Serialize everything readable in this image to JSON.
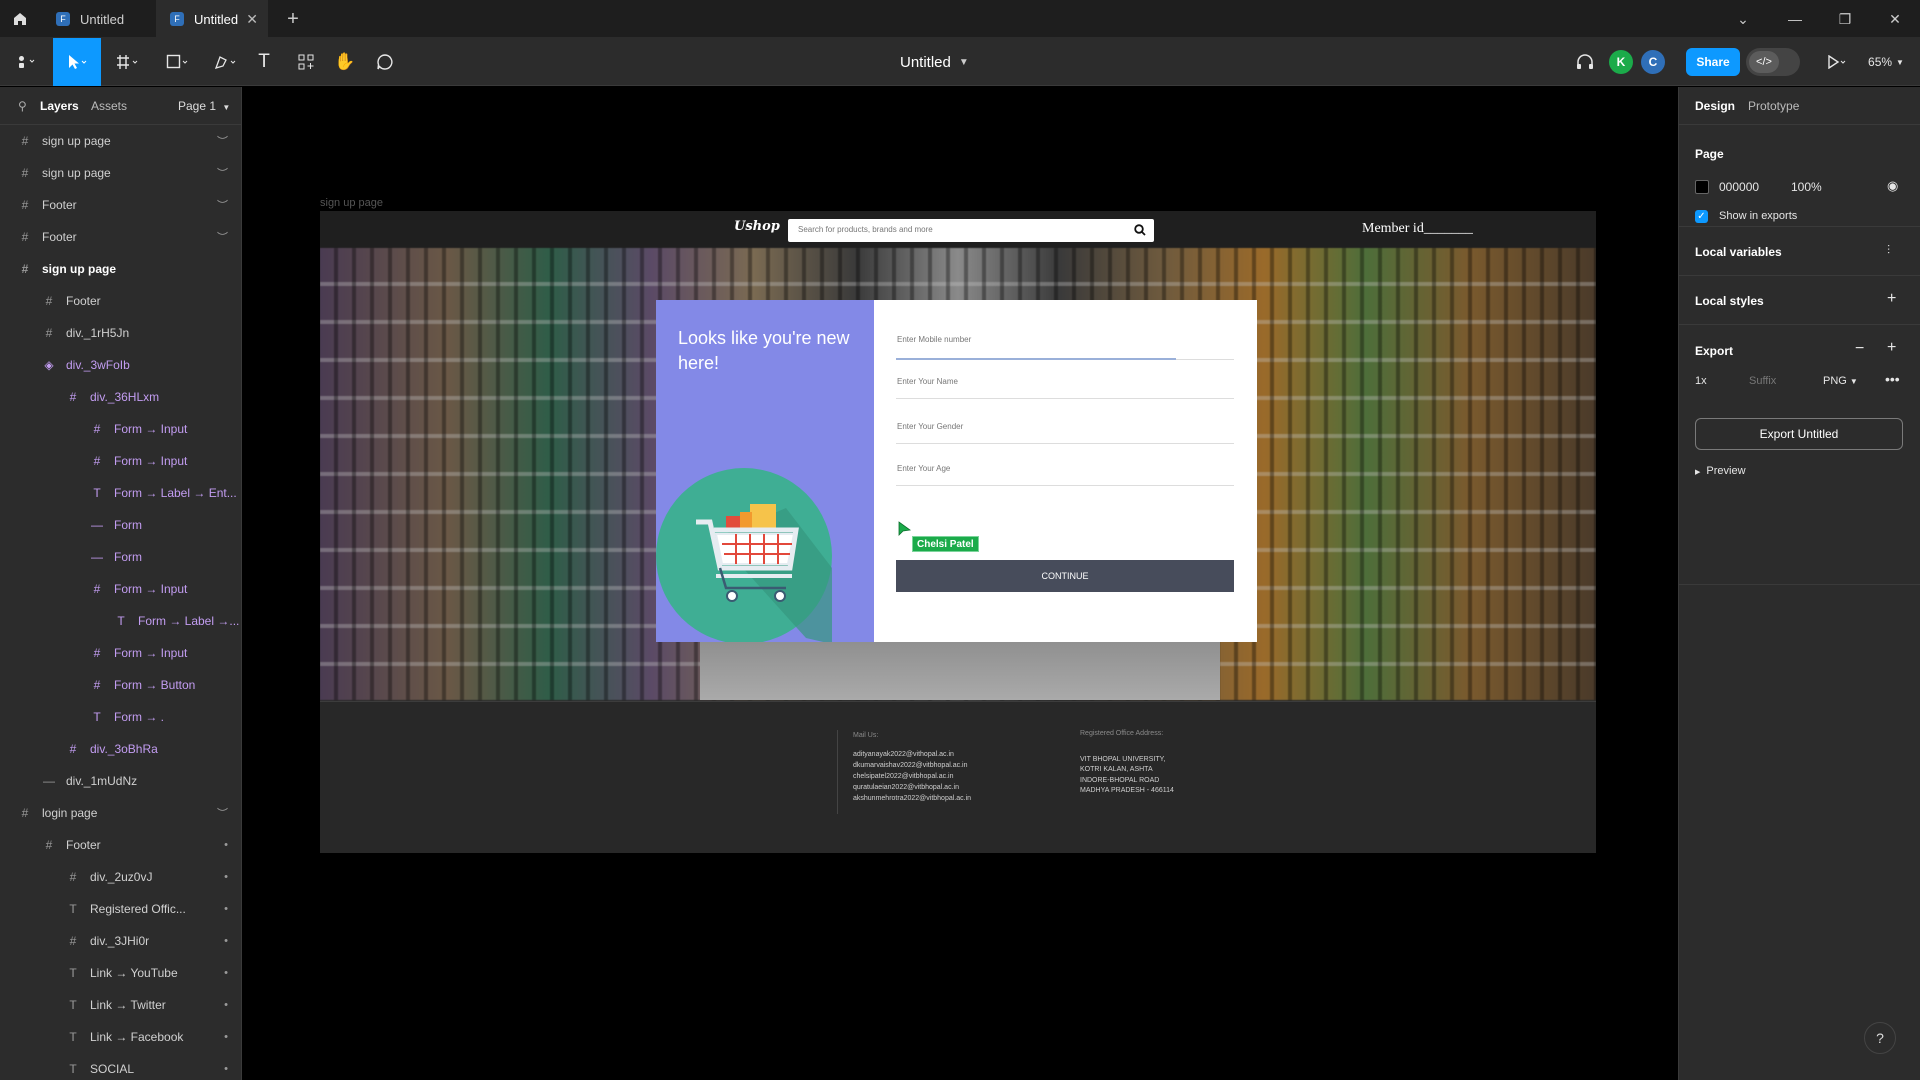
{
  "tabs": [
    {
      "label": "Untitled",
      "active": false
    },
    {
      "label": "Untitled",
      "active": true
    }
  ],
  "toolbar": {
    "doc_title": "Untitled",
    "avatars": [
      {
        "letter": "K",
        "color": "#1bab4a"
      },
      {
        "letter": "C",
        "color": "#2f6fb8"
      }
    ],
    "share_label": "Share",
    "zoom": "65%"
  },
  "left_panel": {
    "tabs": [
      "Layers",
      "Assets"
    ],
    "page": "Page 1",
    "layers": [
      {
        "label": "sign up page",
        "icon": "#",
        "indent": 0,
        "hidden": true
      },
      {
        "label": "sign up page",
        "icon": "#",
        "indent": 0,
        "hidden": true
      },
      {
        "label": "Footer",
        "icon": "#",
        "indent": 0,
        "hidden": true
      },
      {
        "label": "Footer",
        "icon": "#",
        "indent": 0,
        "hidden": true
      },
      {
        "label": "sign up page",
        "icon": "#",
        "indent": 0,
        "bold": true
      },
      {
        "label": "Footer",
        "icon": "#",
        "indent": 1
      },
      {
        "label": "div._1rH5Jn",
        "icon": "#",
        "indent": 1
      },
      {
        "label": "div._3wFoIb",
        "icon": "◈",
        "indent": 1,
        "comp": true
      },
      {
        "label": "div._36HLxm",
        "icon": "#",
        "indent": 2,
        "comp": true
      },
      {
        "label": "Form → Input",
        "icon": "#",
        "indent": 3,
        "comp": true
      },
      {
        "label": "Form → Input",
        "icon": "#",
        "indent": 3,
        "comp": true
      },
      {
        "label": "Form → Label → Ent...",
        "icon": "T",
        "indent": 3,
        "comp": true
      },
      {
        "label": "Form",
        "icon": "—",
        "indent": 3,
        "comp": true
      },
      {
        "label": "Form",
        "icon": "—",
        "indent": 3,
        "comp": true
      },
      {
        "label": "Form → Input",
        "icon": "#",
        "indent": 3,
        "comp": true
      },
      {
        "label": "Form → Label →...",
        "icon": "T",
        "indent": 4,
        "comp": true
      },
      {
        "label": "Form → Input",
        "icon": "#",
        "indent": 3,
        "comp": true
      },
      {
        "label": "Form → Button",
        "icon": "#",
        "indent": 3,
        "comp": true
      },
      {
        "label": "Form → .",
        "icon": "T",
        "indent": 3,
        "comp": true
      },
      {
        "label": "div._3oBhRa",
        "icon": "#",
        "indent": 2,
        "comp": true
      },
      {
        "label": "div._1mUdNz",
        "icon": "—",
        "indent": 1
      },
      {
        "label": "login page",
        "icon": "#",
        "indent": 0,
        "hidden": true
      },
      {
        "label": "Footer",
        "icon": "#",
        "indent": 1,
        "dot": true
      },
      {
        "label": "div._2uz0vJ",
        "icon": "#",
        "indent": 2,
        "dot": true
      },
      {
        "label": "Registered Offic...",
        "icon": "T",
        "indent": 2,
        "dot": true
      },
      {
        "label": "div._3JHi0r",
        "icon": "#",
        "indent": 2,
        "dot": true
      },
      {
        "label": "Link → YouTube",
        "icon": "T",
        "indent": 2,
        "dot": true
      },
      {
        "label": "Link → Twitter",
        "icon": "T",
        "indent": 2,
        "dot": true
      },
      {
        "label": "Link → Facebook",
        "icon": "T",
        "indent": 2,
        "dot": true
      },
      {
        "label": "SOCIAL",
        "icon": "T",
        "indent": 2,
        "dot": true
      }
    ]
  },
  "canvas": {
    "frame_label": "sign up page",
    "logo": "Ushop",
    "search_placeholder": "Search for products, brands and more",
    "member_id": "Member id_______",
    "headline": "Looks like you're new here!",
    "fields": [
      "Enter Mobile number",
      "Enter Your Name",
      "Enter Your Gender",
      "Enter Your Age"
    ],
    "continue_label": "CONTINUE",
    "cursor_user": "Chelsi Patel",
    "footer": {
      "mail_title": "Mail Us:",
      "mails": [
        "adityanayak2022@vithopal.ac.in",
        "dkumarvaishav2022@vitbhopal.ac.in",
        "chelsipatel2022@vitbhopal.ac.in",
        "quratulaeian2022@vitbhopal.ac.in",
        "akshunmehrotra2022@vitbhopal.ac.in"
      ],
      "office_title": "Registered Office Address:",
      "office": [
        "VIT BHOPAL UNIVERSITY,",
        "KOTRI KALAN, ASHTA",
        "INDORE-BHOPAL ROAD",
        "MADHYA PRADESH - 466114"
      ]
    }
  },
  "right_panel": {
    "tabs": [
      "Design",
      "Prototype"
    ],
    "page_title": "Page",
    "page_color": "000000",
    "page_opacity": "100%",
    "show_in_exports": "Show in exports",
    "local_variables": "Local variables",
    "local_styles": "Local styles",
    "export_title": "Export",
    "export_scale": "1x",
    "export_suffix_placeholder": "Suffix",
    "export_format": "PNG",
    "export_button": "Export Untitled",
    "preview": "Preview"
  }
}
